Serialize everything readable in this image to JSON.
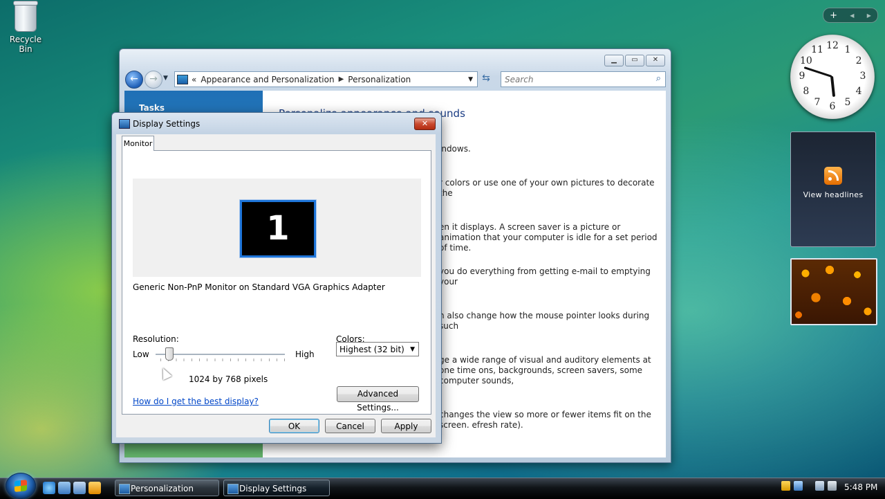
{
  "desktop": {
    "recycle_bin_label": "Recycle Bin",
    "sidebar_controls": {
      "add": "+",
      "prev": "◀",
      "next": "▶"
    },
    "clock_numbers": [
      "12",
      "1",
      "2",
      "3",
      "4",
      "5",
      "6",
      "7",
      "8",
      "9",
      "10",
      "11"
    ],
    "feed_label": "View headlines"
  },
  "personalization_window": {
    "breadcrumb": [
      "Appearance and Personalization",
      "Personalization"
    ],
    "breadcrumb_prefix": "«",
    "search_placeholder": "Search",
    "tasks_label": "Tasks",
    "heading": "Personalize appearance and sounds",
    "texts": [
      "indows.",
      "r colors or use one of your own pictures to decorate the",
      "en it displays. A screen saver is a picture or animation that your computer is idle for a set period of time.",
      "you do everything from getting e-mail to emptying your",
      "n also change how the mouse pointer looks during such",
      "ge a wide range of visual and auditory elements at one time ons, backgrounds, screen savers, some computer sounds,",
      "changes the view so more or fewer items fit on the screen. efresh rate)."
    ]
  },
  "display_settings": {
    "title": "Display Settings",
    "close_glyph": "✕",
    "tab": "Monitor",
    "monitor_number": "1",
    "monitor_name": "Generic Non-PnP Monitor on Standard VGA Graphics Adapter",
    "resolution_label": "Resolution:",
    "low_label": "Low",
    "high_label": "High",
    "resolution_value": "1024 by 768 pixels",
    "resolution_level": 0.05,
    "colors_label": "Colors:",
    "colors_selected": "Highest (32 bit)",
    "help_link": "How do I get the best display?",
    "advanced_button": "Advanced Settings...",
    "ok_button": "OK",
    "cancel_button": "Cancel",
    "apply_button": "Apply"
  },
  "taskbar": {
    "buttons": [
      "Personalization",
      "Display Settings"
    ],
    "time": "5:48 PM"
  }
}
